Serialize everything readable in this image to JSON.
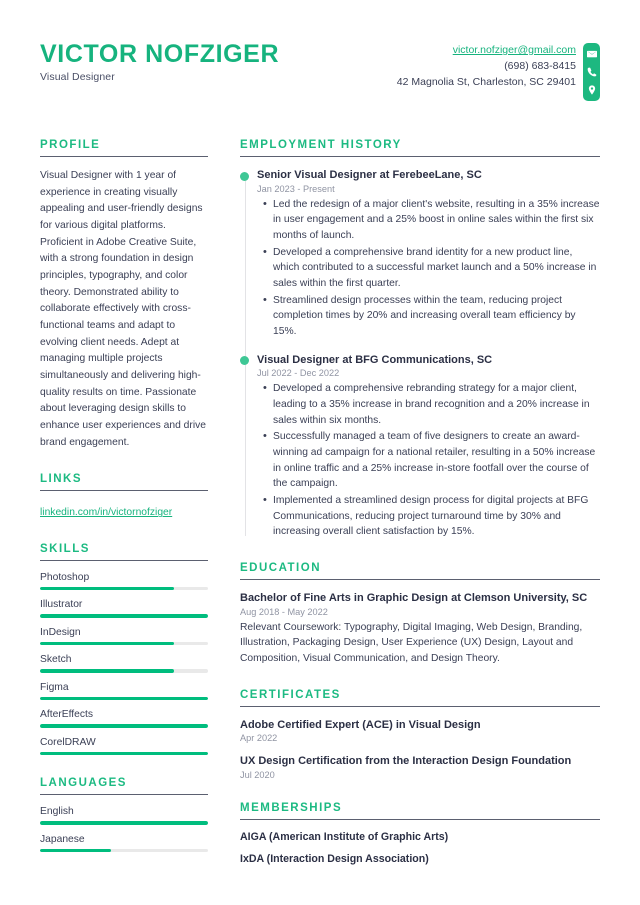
{
  "header": {
    "name": "VICTOR NOFZIGER",
    "job_title": "Visual Designer",
    "email": "victor.nofziger@gmail.com",
    "phone": "(698) 683-8415",
    "address": "42 Magnolia St, Charleston, SC 29401",
    "icons": [
      "envelope-icon",
      "phone-icon",
      "location-pin-icon"
    ]
  },
  "colors": {
    "accent_green": "#16b37e",
    "bar_fill": "#00bd7e",
    "bar_track": "#e9e9e9",
    "heading_rule": "#5b6070",
    "text": "#3a3f55",
    "muted": "#9094a3"
  },
  "sidebar": {
    "profile": {
      "title": "PROFILE",
      "text": "Visual Designer with 1 year of experience in creating visually appealing and user-friendly designs for various digital platforms. Proficient in Adobe Creative Suite, with a strong foundation in design principles, typography, and color theory. Demonstrated ability to collaborate effectively with cross-functional teams and adapt to evolving client needs. Adept at managing multiple projects simultaneously and delivering high-quality results on time. Passionate about leveraging design skills to enhance user experiences and drive brand engagement."
    },
    "links": {
      "title": "LINKS",
      "items": [
        {
          "label": "linkedin.com/in/victornofziger"
        }
      ]
    },
    "skills": {
      "title": "SKILLS",
      "items": [
        {
          "label": "Photoshop",
          "level": 80
        },
        {
          "label": "Illustrator",
          "level": 100
        },
        {
          "label": "InDesign",
          "level": 80
        },
        {
          "label": "Sketch",
          "level": 80
        },
        {
          "label": "Figma",
          "level": 100
        },
        {
          "label": "AfterEffects",
          "level": 100
        },
        {
          "label": "CorelDRAW",
          "level": 100
        }
      ]
    },
    "languages": {
      "title": "LANGUAGES",
      "items": [
        {
          "label": "English",
          "level": 100
        },
        {
          "label": "Japanese",
          "level": 42
        }
      ]
    }
  },
  "main": {
    "employment": {
      "title": "EMPLOYMENT HISTORY",
      "entries": [
        {
          "title": "Senior Visual Designer at FerebeeLane, SC",
          "date": "Jan 2023 - Present",
          "bullets": [
            "Led the redesign of a major client's website, resulting in a 35% increase in user engagement and a 25% boost in online sales within the first six months of launch.",
            "Developed a comprehensive brand identity for a new product line, which contributed to a successful market launch and a 50% increase in sales within the first quarter.",
            "Streamlined design processes within the team, reducing project completion times by 20% and increasing overall team efficiency by 15%."
          ]
        },
        {
          "title": "Visual Designer at BFG Communications, SC",
          "date": "Jul 2022 - Dec 2022",
          "bullets": [
            "Developed a comprehensive rebranding strategy for a major client, leading to a 35% increase in brand recognition and a 20% increase in sales within six months.",
            "Successfully managed a team of five designers to create an award-winning ad campaign for a national retailer, resulting in a 50% increase in online traffic and a 25% increase in-store footfall over the course of the campaign.",
            "Implemented a streamlined design process for digital projects at BFG Communications, reducing project turnaround time by 30% and increasing overall client satisfaction by 15%."
          ]
        }
      ]
    },
    "education": {
      "title": "EDUCATION",
      "entries": [
        {
          "title": "Bachelor of Fine Arts in Graphic Design at Clemson University, SC",
          "date": "Aug 2018 - May 2022",
          "description": "Relevant Coursework: Typography, Digital Imaging, Web Design, Branding, Illustration, Packaging Design, User Experience (UX) Design, Layout and Composition, Visual Communication, and Design Theory."
        }
      ]
    },
    "certificates": {
      "title": "CERTIFICATES",
      "entries": [
        {
          "title": "Adobe Certified Expert (ACE) in Visual Design",
          "date": "Apr 2022"
        },
        {
          "title": "UX Design Certification from the Interaction Design Foundation",
          "date": "Jul 2020"
        }
      ]
    },
    "memberships": {
      "title": "MEMBERSHIPS",
      "entries": [
        {
          "title": "AIGA (American Institute of Graphic Arts)"
        },
        {
          "title": "IxDA (Interaction Design Association)"
        }
      ]
    }
  }
}
